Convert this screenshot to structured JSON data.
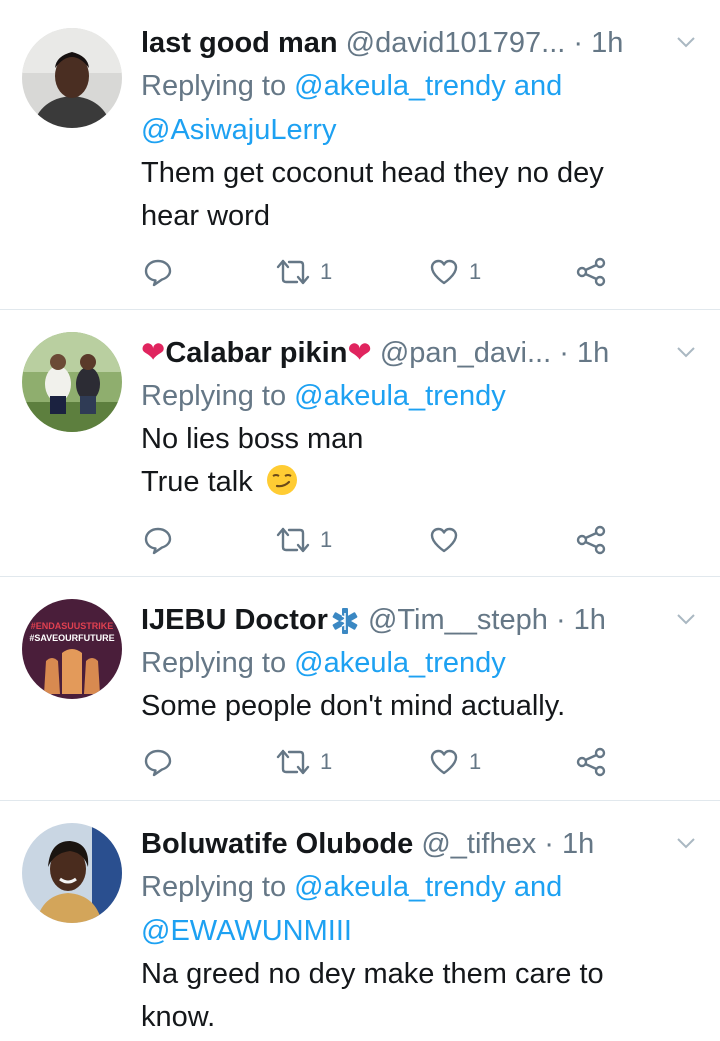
{
  "tweets": [
    {
      "name": "last good man",
      "handle": "@david101797...",
      "dot": "·",
      "time": "1h",
      "replying_prefix": "Replying to",
      "replying_to": "@akeula_trendy and",
      "replying_to_2": "@AsiwajuLerry",
      "body_line1": "Them get coconut head they no dey",
      "body_line2": "hear word",
      "retweets": "1",
      "likes": "1"
    },
    {
      "name_pre_emoji": "❤",
      "name": "Calabar pikin",
      "name_post_emoji": "❤",
      "handle": "@pan_davi...",
      "dot": "·",
      "time": "1h",
      "replying_prefix": "Replying to",
      "replying_to": "@akeula_trendy",
      "body_line1": "No lies boss man",
      "body_line2": "True talk",
      "retweets": "1",
      "likes": ""
    },
    {
      "name": "IJEBU Doctor",
      "handle": "@Tim__steph",
      "dot": "·",
      "time": "1h",
      "replying_prefix": "Replying to",
      "replying_to": "@akeula_trendy",
      "body_line1": "Some people don't mind actually.",
      "retweets": "1",
      "likes": "1",
      "avatar_text1": "#ENDASUUSTRIKE",
      "avatar_text2": "#SAVEOURFUTURE"
    },
    {
      "name": "Boluwatife Olubode",
      "handle": "@_tifhex",
      "dot": "·",
      "time": "1h",
      "replying_prefix": "Replying to",
      "replying_to": "@akeula_trendy and",
      "replying_to_2": "@EWAWUNMIII",
      "body_line1": "Na greed no dey make them care to",
      "body_line2": "know."
    }
  ],
  "colors": {
    "link": "#1da1f2",
    "secondary": "#657786",
    "divider": "#e1e8ed",
    "heart": "#e0245e"
  }
}
